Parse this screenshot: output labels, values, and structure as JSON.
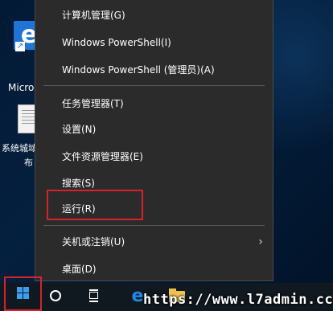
{
  "desktop": {
    "icons": [
      {
        "name": "Microsoft Edge",
        "label": "Micro Edg"
      },
      {
        "name": "document",
        "label_line1": "系统城域",
        "label_line2": "布"
      }
    ]
  },
  "context_menu": {
    "items": [
      {
        "label": "计算机管理(G)"
      },
      {
        "label": "Windows PowerShell(I)"
      },
      {
        "label": "Windows PowerShell (管理员)(A)"
      },
      {
        "label": "任务管理器(T)"
      },
      {
        "label": "设置(N)"
      },
      {
        "label": "文件资源管理器(E)"
      },
      {
        "label": "搜索(S)"
      },
      {
        "label": "运行(R)",
        "highlighted": true
      },
      {
        "label": "关机或注销(U)",
        "has_submenu": true
      },
      {
        "label": "桌面(D)"
      }
    ],
    "highlight_color": "#d7222a"
  },
  "taskbar": {
    "start_icon": "windows-logo-icon",
    "search_icon": "search-circle-icon",
    "task_view_icon": "task-view-icon",
    "pinned": [
      "edge-icon",
      "folder-icon"
    ],
    "accent_color": "#3a9ff1"
  },
  "watermark": {
    "text": "https://www.l7admin.cc"
  }
}
